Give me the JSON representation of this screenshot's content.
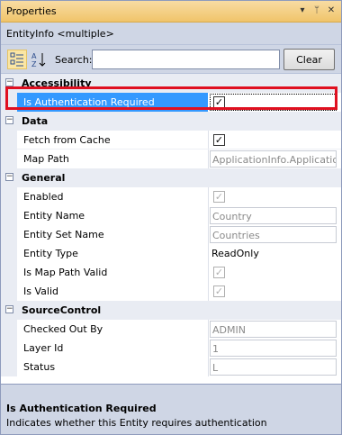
{
  "titlebar": {
    "title": "Properties",
    "dropdown_glyph": "▾",
    "pin_glyph": "ᛘ",
    "close_glyph": "✕"
  },
  "object": {
    "name": "EntityInfo <multiple>"
  },
  "toolbar": {
    "search_label": "Search:",
    "search_value": "",
    "clear_label": "Clear"
  },
  "categories": {
    "accessibility": {
      "label": "Accessibility",
      "toggle": "−"
    },
    "data": {
      "label": "Data",
      "toggle": "−"
    },
    "general": {
      "label": "General",
      "toggle": "−"
    },
    "sourcecontrol": {
      "label": "SourceControl",
      "toggle": "−"
    }
  },
  "props": {
    "is_auth_required": {
      "name": "Is Authentication Required",
      "checked": true
    },
    "fetch_from_cache": {
      "name": "Fetch from Cache",
      "checked": true
    },
    "map_path": {
      "name": "Map Path",
      "value": "ApplicationInfo.Applicatio"
    },
    "enabled": {
      "name": "Enabled",
      "checked": true
    },
    "entity_name": {
      "name": "Entity Name",
      "value": "Country"
    },
    "entity_set_name": {
      "name": "Entity Set Name",
      "value": "Countries"
    },
    "entity_type": {
      "name": "Entity Type",
      "value": "ReadOnly"
    },
    "is_map_path_valid": {
      "name": "Is Map Path Valid",
      "checked": true
    },
    "is_valid": {
      "name": "Is Valid",
      "checked": true
    },
    "checked_out_by": {
      "name": "Checked Out By",
      "value": "ADMIN"
    },
    "layer_id": {
      "name": "Layer Id",
      "value": "1"
    },
    "status": {
      "name": "Status",
      "value": "L"
    }
  },
  "check_glyph": "✓",
  "description": {
    "title": "Is Authentication Required",
    "text": "Indicates whether this Entity requires authentication"
  },
  "colors": {
    "selection": "#3399ff",
    "highlight_border": "#e01020",
    "titlebar": "#f0c46a"
  }
}
